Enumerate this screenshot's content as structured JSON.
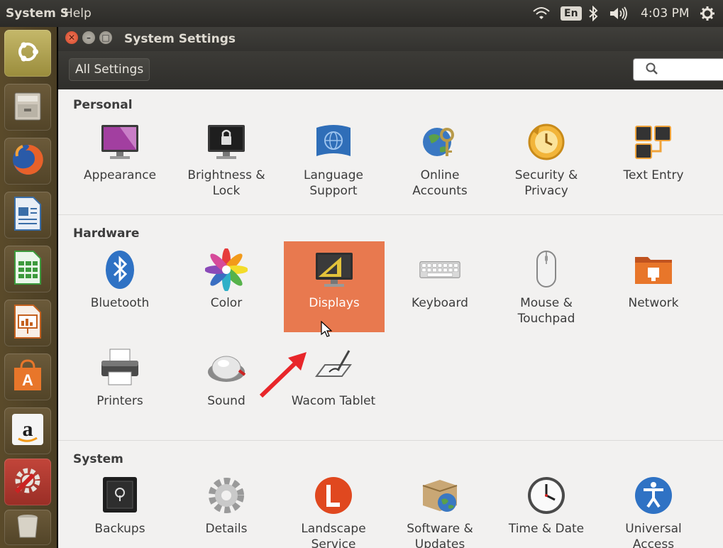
{
  "topbar": {
    "app_title": "System S",
    "menu_help": "Help",
    "keyboard_layout": "En",
    "time": "4:03 PM"
  },
  "launcher": {
    "items": [
      {
        "name": "Dash home",
        "icon": "ubuntu-logo-icon"
      },
      {
        "name": "Files",
        "icon": "file-cabinet-icon"
      },
      {
        "name": "Firefox",
        "icon": "firefox-icon"
      },
      {
        "name": "LibreOffice Writer",
        "icon": "writer-icon"
      },
      {
        "name": "LibreOffice Calc",
        "icon": "calc-icon"
      },
      {
        "name": "LibreOffice Impress",
        "icon": "impress-icon"
      },
      {
        "name": "Ubuntu Software Center",
        "icon": "software-center-icon"
      },
      {
        "name": "Amazon",
        "icon": "amazon-icon"
      },
      {
        "name": "System Settings",
        "icon": "system-settings-icon"
      },
      {
        "name": "Trash",
        "icon": "trash-icon"
      }
    ]
  },
  "window": {
    "title": "System Settings",
    "all_settings": "All Settings",
    "search_placeholder": ""
  },
  "sections": {
    "personal": {
      "title": "Personal",
      "items": [
        "Appearance",
        "Brightness &\nLock",
        "Language\nSupport",
        "Online\nAccounts",
        "Security &\nPrivacy",
        "Text Entry"
      ]
    },
    "hardware": {
      "title": "Hardware",
      "items": [
        "Bluetooth",
        "Color",
        "Displays",
        "Keyboard",
        "Mouse &\nTouchpad",
        "Network",
        "Printers",
        "Sound",
        "Wacom Tablet"
      ]
    },
    "system": {
      "title": "System",
      "items": [
        "Backups",
        "Details",
        "Landscape\nService",
        "Software &\nUpdates",
        "Time & Date",
        "Universal\nAccess"
      ]
    }
  },
  "colors": {
    "selection": "#e8794f",
    "arrow": "#e8262a",
    "topbar": "#2f2e2b"
  }
}
